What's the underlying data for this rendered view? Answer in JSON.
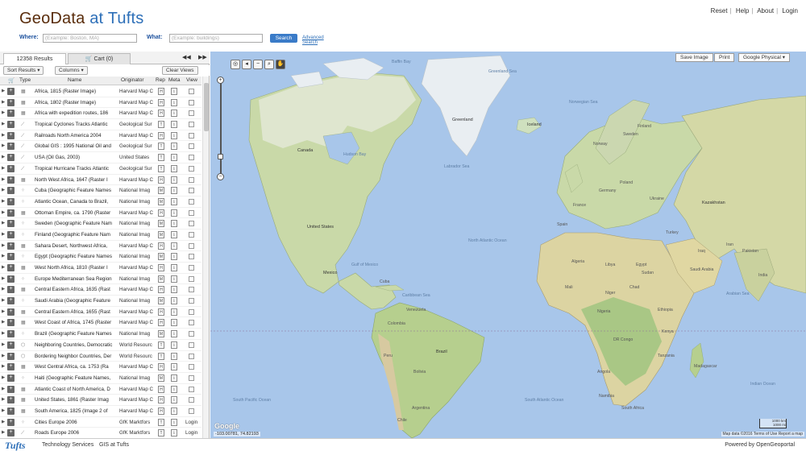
{
  "brand": {
    "part1": "GeoData ",
    "part2": "at Tufts"
  },
  "top_links": [
    "Reset",
    "Help",
    "About",
    "Login"
  ],
  "search": {
    "where_label": "Where:",
    "where_placeholder": "(Example: Boston, MA)",
    "what_label": "What:",
    "what_placeholder": "(Example: buildings)",
    "search_button": "Search",
    "advanced_link": "Advanced Search"
  },
  "tabs": {
    "results": "12358 Results",
    "cart": "Cart (0)",
    "collapse": "◀◀",
    "expand": "▶▶"
  },
  "toolbar": {
    "sort": "Sort Results ▾",
    "columns": "Columns ▾",
    "clear": "Clear Views"
  },
  "columns": {
    "type": "Type",
    "name": "Name",
    "originator": "Originator",
    "rep": "Rep",
    "meta": "Meta",
    "view": "View"
  },
  "rows": [
    {
      "type": "raster",
      "name": "Africa, 1815 (Raster Image)",
      "originator": "Harvard Map C",
      "rep": "H",
      "meta": "i",
      "view": "box"
    },
    {
      "type": "raster",
      "name": "Africa, 1802 (Raster Image)",
      "originator": "Harvard Map C",
      "rep": "H",
      "meta": "i",
      "view": "box"
    },
    {
      "type": "raster",
      "name": "Africa with expedition routes, 186",
      "originator": "Harvard Map C",
      "rep": "H",
      "meta": "i",
      "view": "box"
    },
    {
      "type": "line",
      "name": "Tropical Cyclones Tracks Atlantic",
      "originator": "Geological Sur",
      "rep": "T",
      "meta": "i",
      "view": "box"
    },
    {
      "type": "line",
      "name": "Railroads North America 2004",
      "originator": "Harvard Map C",
      "rep": "H",
      "meta": "i",
      "view": "box"
    },
    {
      "type": "line",
      "name": "Global GIS : 1995 National Oil and",
      "originator": "Geological Sur",
      "rep": "T",
      "meta": "i",
      "view": "box"
    },
    {
      "type": "line",
      "name": "USA (Oil Gas, 2003)",
      "originator": "United States",
      "rep": "T",
      "meta": "i",
      "view": "box"
    },
    {
      "type": "line",
      "name": "Tropical Hurricane Tracks Atlantic",
      "originator": "Geological Sur",
      "rep": "T",
      "meta": "i",
      "view": "box"
    },
    {
      "type": "raster",
      "name": "North West Africa, 1647 (Raster I",
      "originator": "Harvard Map C",
      "rep": "H",
      "meta": "i",
      "view": "box"
    },
    {
      "type": "point",
      "name": "Cuba (Geographic Feature Names",
      "originator": "National Imag",
      "rep": "M",
      "meta": "i",
      "view": "box"
    },
    {
      "type": "point",
      "name": "Atlantic Ocean, Canada to Brazil,",
      "originator": "National Imag",
      "rep": "M",
      "meta": "i",
      "view": "box"
    },
    {
      "type": "raster",
      "name": "Ottoman Empire, ca. 1790 (Raster",
      "originator": "Harvard Map C",
      "rep": "H",
      "meta": "i",
      "view": "box"
    },
    {
      "type": "point",
      "name": "Sweden (Geographic Feature Nam",
      "originator": "National Imag",
      "rep": "M",
      "meta": "i",
      "view": "box"
    },
    {
      "type": "point",
      "name": "Finland (Geographic Feature Nam",
      "originator": "National Imag",
      "rep": "M",
      "meta": "i",
      "view": "box"
    },
    {
      "type": "raster",
      "name": "Sahara Desert, Northwest Africa,",
      "originator": "Harvard Map C",
      "rep": "H",
      "meta": "i",
      "view": "box"
    },
    {
      "type": "point",
      "name": "Egypt (Geographic Feature Names",
      "originator": "National Imag",
      "rep": "M",
      "meta": "i",
      "view": "box"
    },
    {
      "type": "raster",
      "name": "West North Africa, 1810 (Raster I",
      "originator": "Harvard Map C",
      "rep": "H",
      "meta": "i",
      "view": "box"
    },
    {
      "type": "point",
      "name": "Europe Mediterranean Sea Region",
      "originator": "National Imag",
      "rep": "M",
      "meta": "i",
      "view": "box"
    },
    {
      "type": "raster",
      "name": "Central Eastern Africa, 1635 (Rast",
      "originator": "Harvard Map C",
      "rep": "H",
      "meta": "i",
      "view": "box"
    },
    {
      "type": "point",
      "name": "Saudi Arabia (Geographic Feature",
      "originator": "National Imag",
      "rep": "M",
      "meta": "i",
      "view": "box"
    },
    {
      "type": "raster",
      "name": "Central Eastern Africa, 1655 (Rast",
      "originator": "Harvard Map C",
      "rep": "H",
      "meta": "i",
      "view": "box"
    },
    {
      "type": "raster",
      "name": "West Coast of Africa, 1745 (Raster",
      "originator": "Harvard Map C",
      "rep": "H",
      "meta": "i",
      "view": "box"
    },
    {
      "type": "point",
      "name": "Brazil (Geographic Feature Names",
      "originator": "National Imag",
      "rep": "M",
      "meta": "i",
      "view": "box"
    },
    {
      "type": "polygon",
      "name": "Neighboring Countries, Democratic",
      "originator": "World Resourc",
      "rep": "T",
      "meta": "i",
      "view": "box"
    },
    {
      "type": "polygon",
      "name": "Bordering Neighbor Countries, Der",
      "originator": "World Resourc",
      "rep": "T",
      "meta": "i",
      "view": "box"
    },
    {
      "type": "raster",
      "name": "West Central Africa, ca. 1753 (Ra",
      "originator": "Harvard Map C",
      "rep": "H",
      "meta": "i",
      "view": "box"
    },
    {
      "type": "point",
      "name": "Haiti (Geographic Feature Names,",
      "originator": "National Imag",
      "rep": "M",
      "meta": "i",
      "view": "box"
    },
    {
      "type": "raster",
      "name": "Atlantic Coast of North America, D",
      "originator": "Harvard Map C",
      "rep": "H",
      "meta": "i",
      "view": "box"
    },
    {
      "type": "raster",
      "name": "United States, 1861 (Raster Imag",
      "originator": "Harvard Map C",
      "rep": "H",
      "meta": "i",
      "view": "box"
    },
    {
      "type": "raster",
      "name": "South America, 1825 (Image 2 of",
      "originator": "Harvard Map C",
      "rep": "H",
      "meta": "i",
      "view": "box"
    },
    {
      "type": "point",
      "name": "Cities Europe 2006",
      "originator": "GfK Marktfors",
      "rep": "T",
      "meta": "i",
      "view": "Login"
    },
    {
      "type": "line",
      "name": "Roads Europe 2006",
      "originator": "GfK Marktfors",
      "rep": "T",
      "meta": "i",
      "view": "Login"
    }
  ],
  "map": {
    "buttons": {
      "save": "Save Image",
      "print": "Print",
      "basemap": "Google Physical ▾"
    },
    "coords": "-103.00781, 74.82193",
    "attribution": "Map data ©2016  Terms of Use   Report a map",
    "scale_km": "1000 km",
    "scale_mi": "1000 mi",
    "logo": "Google",
    "labels": [
      {
        "t": "Greenland",
        "cls": "big"
      },
      {
        "t": "Iceland",
        "cls": "big"
      },
      {
        "t": "Canada",
        "cls": "big"
      },
      {
        "t": "United States",
        "cls": "big"
      },
      {
        "t": "Mexico",
        "cls": "big"
      },
      {
        "t": "Cuba",
        "cls": ""
      },
      {
        "t": "Venezuela",
        "cls": ""
      },
      {
        "t": "Colombia",
        "cls": ""
      },
      {
        "t": "Peru",
        "cls": ""
      },
      {
        "t": "Brazil",
        "cls": "big"
      },
      {
        "t": "Bolivia",
        "cls": ""
      },
      {
        "t": "Argentina",
        "cls": ""
      },
      {
        "t": "Chile",
        "cls": ""
      },
      {
        "t": "Algeria",
        "cls": ""
      },
      {
        "t": "Libya",
        "cls": ""
      },
      {
        "t": "Egypt",
        "cls": ""
      },
      {
        "t": "Mali",
        "cls": ""
      },
      {
        "t": "Niger",
        "cls": ""
      },
      {
        "t": "Chad",
        "cls": ""
      },
      {
        "t": "Sudan",
        "cls": ""
      },
      {
        "t": "Nigeria",
        "cls": ""
      },
      {
        "t": "Ethiopia",
        "cls": ""
      },
      {
        "t": "DR Congo",
        "cls": ""
      },
      {
        "t": "Kenya",
        "cls": ""
      },
      {
        "t": "Tanzania",
        "cls": ""
      },
      {
        "t": "Angola",
        "cls": ""
      },
      {
        "t": "Namibia",
        "cls": ""
      },
      {
        "t": "South Africa",
        "cls": ""
      },
      {
        "t": "Madagascar",
        "cls": ""
      },
      {
        "t": "Saudi Arabia",
        "cls": ""
      },
      {
        "t": "Iran",
        "cls": ""
      },
      {
        "t": "Turkey",
        "cls": ""
      },
      {
        "t": "Ukraine",
        "cls": ""
      },
      {
        "t": "Kazakhstan",
        "cls": "big"
      },
      {
        "t": "France",
        "cls": ""
      },
      {
        "t": "Spain",
        "cls": ""
      },
      {
        "t": "Germany",
        "cls": ""
      },
      {
        "t": "Poland",
        "cls": ""
      },
      {
        "t": "Norway",
        "cls": ""
      },
      {
        "t": "Sweden",
        "cls": ""
      },
      {
        "t": "Finland",
        "cls": ""
      },
      {
        "t": "Iraq",
        "cls": ""
      },
      {
        "t": "Pakistan",
        "cls": ""
      },
      {
        "t": "India",
        "cls": ""
      },
      {
        "t": "Hudson Bay",
        "cls": "ocean"
      },
      {
        "t": "Baffin Bay",
        "cls": "ocean"
      },
      {
        "t": "Labrador Sea",
        "cls": "ocean"
      },
      {
        "t": "Greenland Sea",
        "cls": "ocean"
      },
      {
        "t": "Norwegian Sea",
        "cls": "ocean"
      },
      {
        "t": "North Atlantic Ocean",
        "cls": "ocean"
      },
      {
        "t": "South Atlantic Ocean",
        "cls": "ocean"
      },
      {
        "t": "South Pacific Ocean",
        "cls": "ocean"
      },
      {
        "t": "Indian Ocean",
        "cls": "ocean"
      },
      {
        "t": "Gulf of Mexico",
        "cls": "ocean"
      },
      {
        "t": "Caribbean Sea",
        "cls": "ocean"
      },
      {
        "t": "Arabian Sea",
        "cls": "ocean"
      }
    ]
  },
  "footer": {
    "logo": "Tufts",
    "link1": "Technology Services",
    "link2": "GIS at Tufts",
    "powered": "Powered by OpenGeoportal"
  }
}
